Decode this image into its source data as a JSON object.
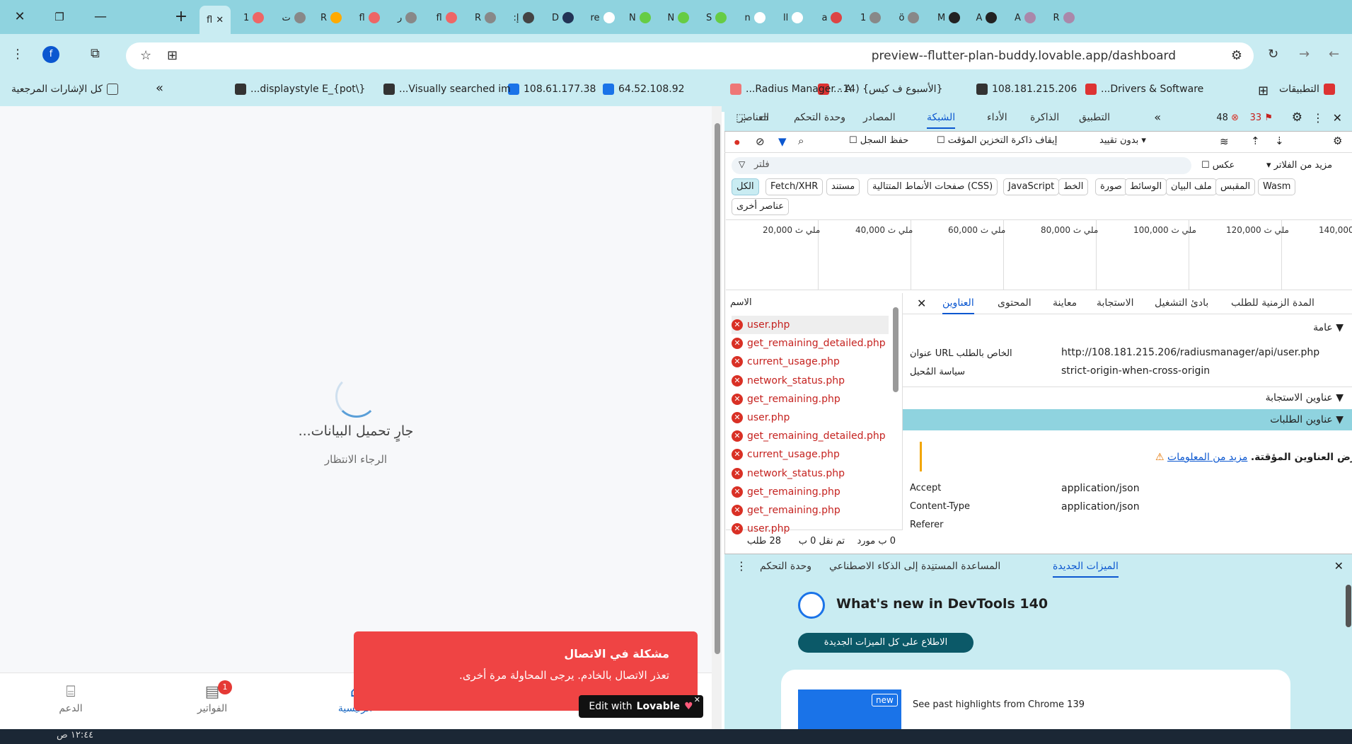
{
  "tabs": {
    "active_label": "fl",
    "items": [
      "fl",
      "1",
      "ت",
      "R",
      "fl",
      "ر",
      "fl",
      "R",
      "إ:",
      "D",
      "re",
      "N",
      "N",
      "S",
      "n",
      "ll",
      "a",
      "1",
      "ö",
      "M",
      "A",
      "A",
      "R"
    ]
  },
  "window": {
    "close": "✕",
    "restore": "❐",
    "minimize": "—",
    "newtab": "+"
  },
  "address": {
    "url": "preview--flutter-plan-buddy.lovable.app/dashboard",
    "profile": "f"
  },
  "bookmarks": {
    "apps": "التطبيقات",
    "items": [
      "Drivers & Software...",
      "108.181.215.206",
      "{الأسبوع ف كيس} (14...",
      "Radius Manager - A...",
      "64.52.108.92",
      "108.61.177.38",
      "Visually searched im...",
      "{\\displaystyle E_{pot..."
    ],
    "more": "»",
    "all": "كل الإشارات المرجعية"
  },
  "page": {
    "loading_title": "جارٍ تحميل البيانات...",
    "loading_sub": "الرجاء الانتظار",
    "nav": {
      "support": "الدعم",
      "invoices": "الفواتير",
      "home": "الرئيسية",
      "invoices_badge": "1"
    },
    "toast": {
      "title": "مشكلة في الاتصال",
      "body": "تعذر الاتصال بالخادم. يرجى المحاولة مرة أخرى."
    },
    "lovable": {
      "brand": "Lovable",
      "edit": "Edit with"
    }
  },
  "devtools": {
    "tabs": [
      "التطبيق",
      "الذاكرة",
      "الأداء",
      "الشبكة",
      "المصادر",
      "وحدة التحكم",
      "العناصر"
    ],
    "selected_tab": "الشبكة",
    "errors": "48",
    "warnings": "33",
    "throttle": "بدون تقييد",
    "disable_cache": "إيقاف ذاكرة التخزين المؤقت",
    "preserve_log": "حفظ السجل",
    "filter_placeholder": "فلتر",
    "invert": "عكس",
    "more_filters": "مزيد من الفلاتر",
    "chips": [
      "الكل",
      "Fetch/XHR",
      "مستند",
      "صفحات الأنماط المتتالية (CSS)",
      "JavaScript",
      "الخط",
      "صورة",
      "الوسائط",
      "ملف البيان",
      "المقبس",
      "Wasm",
      "عناصر أخرى"
    ],
    "ticks": [
      "20,000 ملي ث",
      "40,000 ملي ث",
      "60,000 ملي ث",
      "80,000 ملي ث",
      "100,000 ملي ث",
      "120,000 ملي ث",
      "140,000 ملي ث"
    ],
    "name_header": "الاسم",
    "requests": [
      "user.php",
      "get_remaining_detailed.php",
      "current_usage.php",
      "network_status.php",
      "get_remaining.php",
      "user.php",
      "get_remaining_detailed.php",
      "current_usage.php",
      "network_status.php",
      "get_remaining.php",
      "get_remaining.php",
      "user.php"
    ],
    "detail_tabs": [
      "المدة الزمنية للطلب",
      "بادئ التشغيل",
      "الاستجابة",
      "معاينة",
      "المحتوى",
      "العناوين"
    ],
    "general": "عامة",
    "url_key": "عنوان URL الخاص بالطلب",
    "url_val": "http://108.181.215.206/radiusmanager/api/user.php",
    "policy_key": "سياسة المُحيل",
    "policy_val": "strict-origin-when-cross-origin",
    "resp_headers": "عناوين الاستجابة",
    "req_headers": "عناوين الطلبات",
    "provisional": "يتم عرض العناوين المؤقتة.",
    "learn_more": "مزيد من المعلومات",
    "h_accept": "Accept",
    "h_accept_v": "application/json",
    "h_ct": "Content-Type",
    "h_ct_v": "application/json",
    "h_ref": "Referer",
    "status": {
      "requests": "28 طلب",
      "transferred": "تم نقل 0 ب",
      "resources": "0 ب مورد"
    },
    "drawer_tabs": [
      "الميزات الجديدة",
      "المساعدة المستنِدة إلى الذكاء الاصطناعي",
      "وحدة التحكم"
    ],
    "whats_new": "What's new in DevTools 140",
    "see_all": "الاطلاع على كل الميزات الجديدة",
    "past": "See past highlights from Chrome 139",
    "new_badge": "new"
  },
  "taskbar": {
    "time": "١٢:٤٤ ص"
  }
}
